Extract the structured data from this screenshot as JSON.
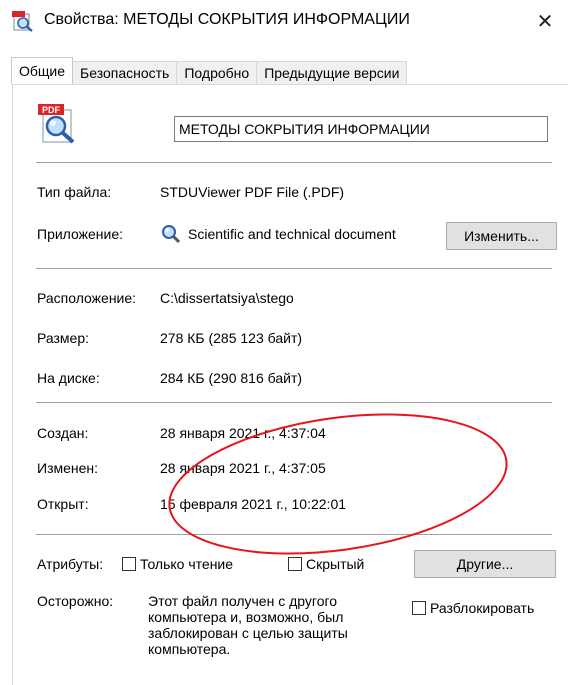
{
  "window": {
    "title": "Свойства: МЕТОДЫ СОКРЫТИЯ ИНФОРМАЦИИ",
    "close_label": "✕"
  },
  "tabs": [
    {
      "label": "Общие"
    },
    {
      "label": "Безопасность"
    },
    {
      "label": "Подробно"
    },
    {
      "label": "Предыдущие версии"
    }
  ],
  "file": {
    "name": "МЕТОДЫ СОКРЫТИЯ ИНФОРМАЦИИ",
    "icon_badge": "PDF"
  },
  "info": {
    "type_label": "Тип файла:",
    "type_value": "STDUViewer PDF File (.PDF)",
    "app_label": "Приложение:",
    "app_value": "Scientific and technical document",
    "change_button": "Изменить...",
    "location_label": "Расположение:",
    "location_value": "C:\\dissertatsiya\\stego",
    "size_label": "Размер:",
    "size_value": "278 КБ (285 123 байт)",
    "disk_label": "На диске:",
    "disk_value": "284 КБ (290 816 байт)"
  },
  "dates": {
    "created_label": "Создан:",
    "created_value": "28 января 2021 г., 4:37:04",
    "modified_label": "Изменен:",
    "modified_value": "28 января 2021 г., 4:37:05",
    "opened_label": "Открыт:",
    "opened_value": "15 февраля 2021 г., 10:22:01"
  },
  "attributes": {
    "label": "Атрибуты:",
    "readonly_label": "Только чтение",
    "hidden_label": "Скрытый",
    "other_button": "Другие..."
  },
  "security": {
    "label": "Осторожно:",
    "text": "Этот файл получен с другого компьютера и, возможно, был заблокирован с целью защиты компьютера.",
    "unblock_label": "Разблокировать"
  },
  "colors": {
    "annotation": "#e8141c",
    "tab_bg": "#f0f0f0",
    "button_bg": "#e1e1e1"
  },
  "icons": {
    "title": "pdf-magnifier-icon",
    "file": "pdf-magnifier-icon",
    "app": "magnifier-app-icon",
    "close": "close-icon"
  }
}
